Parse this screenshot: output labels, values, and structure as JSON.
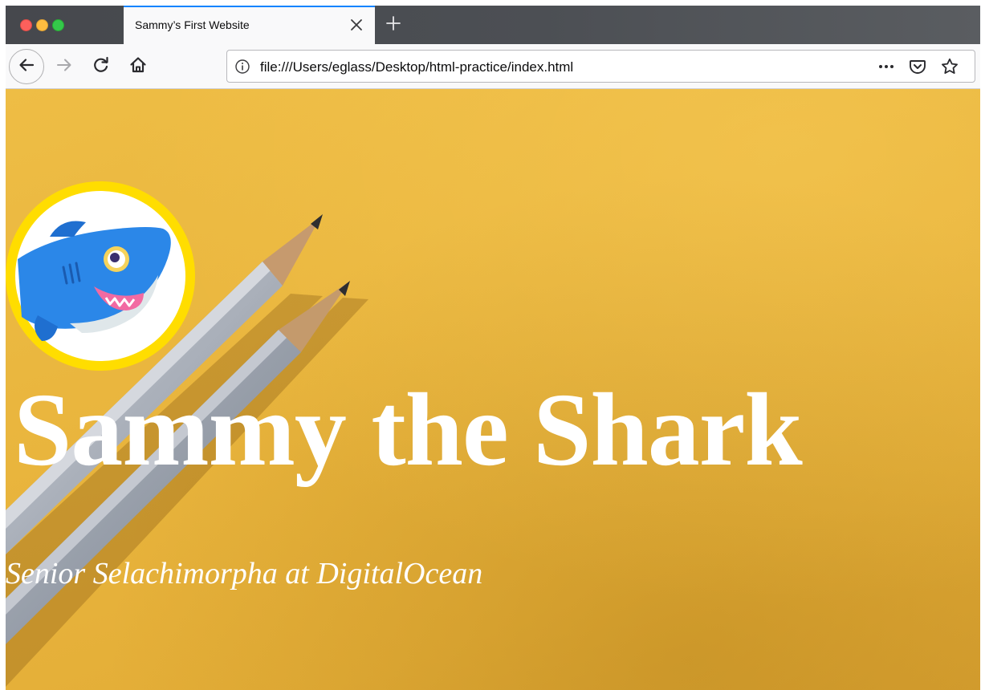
{
  "browser": {
    "tab": {
      "title": "Sammy’s First Website",
      "active_accent": "#0a84ff"
    },
    "url": "file:///Users/eglass/Desktop/html-practice/index.html",
    "icons": {
      "close": "close-icon",
      "new_tab": "plus-icon",
      "back": "back-arrow-icon",
      "forward": "forward-arrow-icon",
      "reload": "reload-icon",
      "home": "home-icon",
      "site_info": "info-icon",
      "page_actions": "more-horizontal-icon",
      "pocket": "pocket-icon",
      "bookmark": "star-icon"
    },
    "traffic_lights": [
      "#fc605c",
      "#fdbc40",
      "#34c84a"
    ]
  },
  "page": {
    "background_color": "#e9b53d",
    "avatar_ring_color": "#ffdd00",
    "title": "Sammy the Shark",
    "subtitle": "Senior Selachimorpha at DigitalOcean"
  }
}
